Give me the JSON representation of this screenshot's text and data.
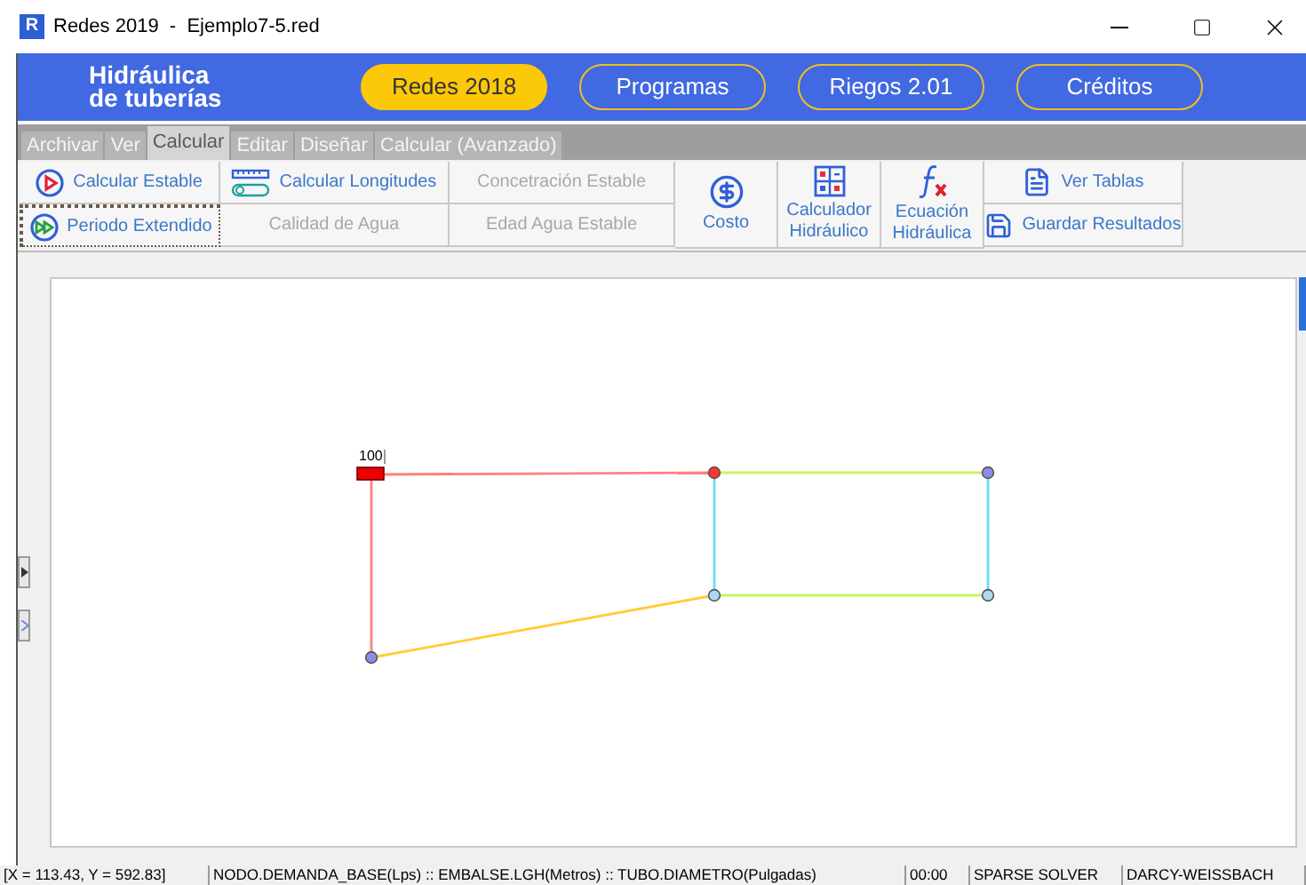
{
  "window": {
    "app_icon_letter": "R",
    "title": "Redes 2019  -  Ejemplo7-5.red"
  },
  "header": {
    "brand_lines": [
      "Hidráulica",
      "de tuberías"
    ],
    "nav": [
      {
        "label": "Redes 2018",
        "selected": true
      },
      {
        "label": "Programas",
        "selected": false
      },
      {
        "label": "Riegos 2.01",
        "selected": false
      },
      {
        "label": "Créditos",
        "selected": false
      }
    ]
  },
  "tabs": [
    {
      "label": "Archivar",
      "selected": false
    },
    {
      "label": "Ver",
      "selected": false
    },
    {
      "label": "Calcular",
      "selected": true
    },
    {
      "label": "Editar",
      "selected": false
    },
    {
      "label": "Diseñar",
      "selected": false
    },
    {
      "label": "Calcular (Avanzado)",
      "selected": false
    }
  ],
  "ribbon": [
    {
      "kind": "stack",
      "buttons": [
        {
          "label": "Calcular Estable",
          "disabled": false,
          "focused": false
        },
        {
          "label": "Periodo Extendido",
          "disabled": false,
          "focused": true
        }
      ]
    },
    {
      "kind": "stack",
      "buttons": [
        {
          "label": "Calcular Longitudes",
          "disabled": false,
          "focused": false
        },
        {
          "label": "Calidad de Agua",
          "disabled": true,
          "focused": false
        }
      ]
    },
    {
      "kind": "stack",
      "buttons": [
        {
          "label": "Concetración Estable",
          "disabled": true,
          "focused": false
        },
        {
          "label": "Edad Agua Estable",
          "disabled": true,
          "focused": false
        }
      ]
    },
    {
      "kind": "large",
      "buttons": [
        {
          "label": "Costo",
          "disabled": false
        }
      ]
    },
    {
      "kind": "large",
      "buttons": [
        {
          "label": "Calculador Hidráulico",
          "disabled": false
        }
      ]
    },
    {
      "kind": "large",
      "buttons": [
        {
          "label": "Ecuación Hidráulica",
          "disabled": false
        }
      ]
    },
    {
      "kind": "stack",
      "buttons": [
        {
          "label": "Ver Tablas",
          "disabled": false,
          "focused": false
        },
        {
          "label": "Guardar Resultados",
          "disabled": false,
          "focused": false
        }
      ]
    }
  ],
  "network": {
    "nodes": [
      {
        "kind": "reservoir",
        "color": "#ee0000",
        "label": "100"
      },
      {
        "kind": "junction",
        "color": "#ff3333"
      },
      {
        "kind": "junction",
        "color": "#8c8ce8"
      },
      {
        "kind": "junction",
        "color": "#aed8f0"
      },
      {
        "kind": "junction",
        "color": "#aed8f0"
      },
      {
        "kind": "junction",
        "color": "#8c8ce8"
      }
    ],
    "pipes": [
      {
        "color": "#ff8080"
      },
      {
        "color": "#ff8080"
      },
      {
        "color": "#ccf266"
      },
      {
        "color": "#66e0ee"
      },
      {
        "color": "#66e0ee"
      },
      {
        "color": "#ccf266"
      },
      {
        "color": "#ffcc33"
      }
    ]
  },
  "status_bar": [
    "[X = 113.43, Y = 592.83]",
    "NODO.DEMANDA_BASE(Lps)  ::  EMBALSE.LGH(Metros)  ::  TUBO.DIAMETRO(Pulgadas)",
    "00:00",
    "SPARSE SOLVER",
    "DARCY-WEISSBACH"
  ]
}
